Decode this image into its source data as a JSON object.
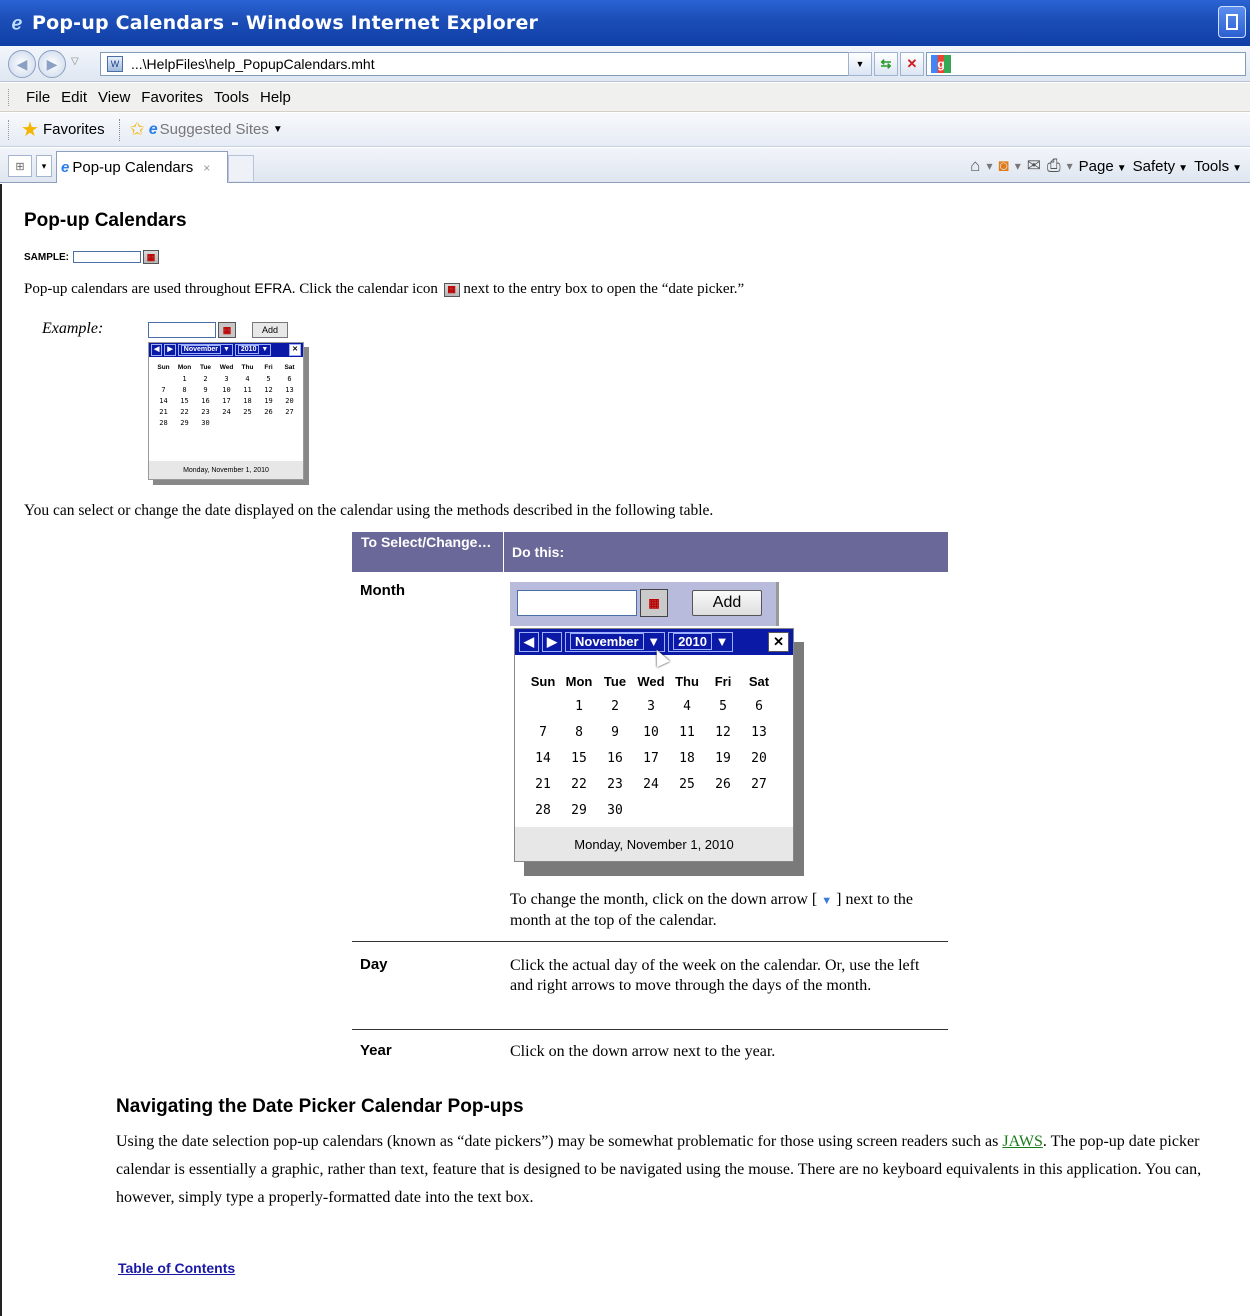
{
  "window": {
    "title": "Pop-up Calendars - Windows Internet Explorer"
  },
  "address": {
    "url": "...\\HelpFiles\\help_PopupCalendars.mht"
  },
  "menu": [
    "File",
    "Edit",
    "View",
    "Favorites",
    "Tools",
    "Help"
  ],
  "favorites_bar": {
    "favorites_label": "Favorites",
    "suggested_label": "Suggested Sites"
  },
  "tabs": {
    "active_tab": "Pop-up Calendars",
    "close_glyph": "×"
  },
  "command_bar": {
    "page": "Page",
    "safety": "Safety",
    "tools": "Tools"
  },
  "content": {
    "title": "Pop-up Calendars",
    "sample_label": "SAMPLE:",
    "intro_before": "Pop-up calendars are used throughout",
    "intro_app": "EFRA",
    "intro_mid": ".   Click the calendar icon",
    "intro_after": "next to the entry box to open the “date picker.”",
    "example_label": "Example:",
    "methods_text": "You can select or change the date displayed on the calendar using the methods described in the following table."
  },
  "calendar": {
    "add_label": "Add",
    "month": "November",
    "year": "2010",
    "close": "✕",
    "weekdays": [
      "Sun",
      "Mon",
      "Tue",
      "Wed",
      "Thu",
      "Fri",
      "Sat"
    ],
    "weeks": [
      [
        "",
        "1",
        "2",
        "3",
        "4",
        "5",
        "6"
      ],
      [
        "7",
        "8",
        "9",
        "10",
        "11",
        "12",
        "13"
      ],
      [
        "14",
        "15",
        "16",
        "17",
        "18",
        "19",
        "20"
      ],
      [
        "21",
        "22",
        "23",
        "24",
        "25",
        "26",
        "27"
      ],
      [
        "28",
        "29",
        "30",
        "",
        "",
        "",
        ""
      ]
    ],
    "footer": "Monday, November 1, 2010"
  },
  "table": {
    "header_col1": "To Select/Change…",
    "header_col2": "Do this:",
    "rows": [
      {
        "label": "Month",
        "desc_before": "To change the month, click on the down arrow [",
        "desc_after": "] next to the month at the top of the calendar."
      },
      {
        "label": "Day",
        "desc": "Click the actual day of the week on the calendar.  Or, use the left and right arrows to move through the days of the month."
      },
      {
        "label": "Year",
        "desc": "Click on the down arrow next to the year."
      }
    ]
  },
  "navigating": {
    "heading": "Navigating the Date Picker Calendar Pop-ups",
    "para_before": "Using the date selection pop-up calendars (known as “date pickers”) may be somewhat problematic for those using screen readers such as",
    "link": "JAWS",
    "para_after": ". The pop-up date picker calendar is essentially a graphic, rather than text, feature that is designed to be navigated using the mouse.   There are no keyboard equivalents in this application.  You can, however, simply type a properly-formatted date into the text box."
  },
  "toc_link": "Table of Contents"
}
